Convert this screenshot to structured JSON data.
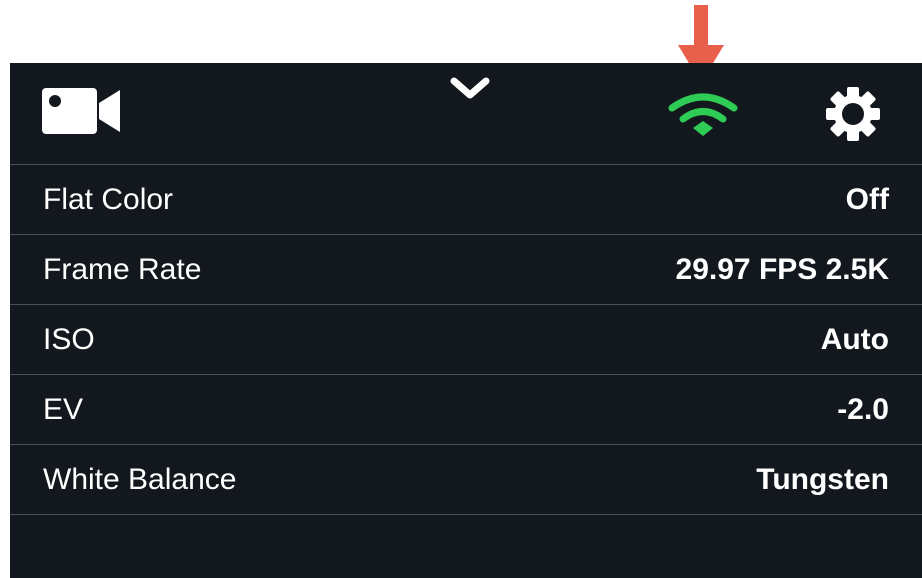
{
  "topbar": {
    "icons": [
      "video-camera-icon",
      "chevron-down-icon",
      "wifi-icon",
      "gear-icon"
    ],
    "wifi_color": "#2ecc55"
  },
  "annotation": {
    "icon": "red-down-arrow",
    "color": "#e8604c"
  },
  "settings": {
    "rows": [
      {
        "label": "Flat Color",
        "value": "Off"
      },
      {
        "label": "Frame Rate",
        "value": "29.97 FPS 2.5K"
      },
      {
        "label": "ISO",
        "value": "Auto"
      },
      {
        "label": "EV",
        "value": "-2.0"
      },
      {
        "label": "White Balance",
        "value": "Tungsten"
      }
    ]
  },
  "colors": {
    "background": "#13181e",
    "divider": "#4a5058",
    "text": "#ffffff"
  }
}
